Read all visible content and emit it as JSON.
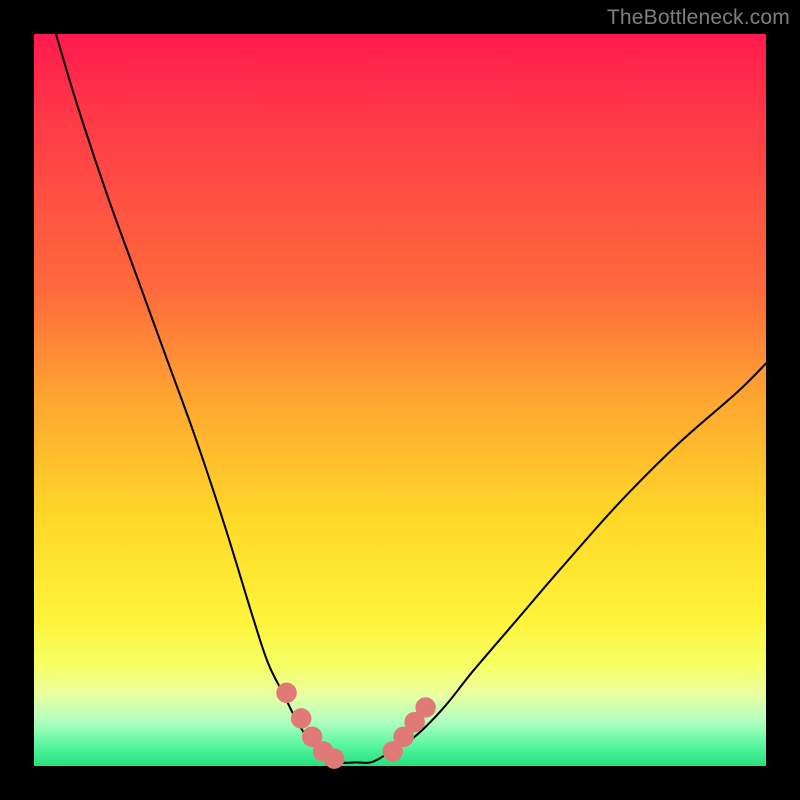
{
  "watermark": "TheBottleneck.com",
  "chart_data": {
    "type": "line",
    "title": "",
    "xlabel": "",
    "ylabel": "",
    "xlim": [
      0,
      100
    ],
    "ylim": [
      0,
      100
    ],
    "series": [
      {
        "name": "bottleneck-curve",
        "x": [
          3,
          6,
          10,
          14,
          18,
          22,
          26,
          30,
          32,
          34,
          36,
          38,
          40,
          42,
          44,
          46,
          48,
          52,
          56,
          60,
          66,
          72,
          80,
          88,
          96,
          100
        ],
        "y": [
          100,
          90,
          78,
          67,
          56,
          45,
          33,
          20,
          14,
          10,
          6,
          3,
          1.5,
          0.5,
          0.5,
          0.5,
          1.5,
          4,
          8,
          13,
          20,
          27,
          36,
          44,
          51,
          55
        ]
      }
    ],
    "markers": {
      "name": "highlighted-points",
      "color": "#e07a76",
      "points": [
        {
          "x": 34.5,
          "y": 10
        },
        {
          "x": 36.5,
          "y": 6.5
        },
        {
          "x": 38,
          "y": 4
        },
        {
          "x": 39.5,
          "y": 2
        },
        {
          "x": 41,
          "y": 1
        },
        {
          "x": 49,
          "y": 2
        },
        {
          "x": 50.5,
          "y": 4
        },
        {
          "x": 52,
          "y": 6
        },
        {
          "x": 53.5,
          "y": 8
        }
      ]
    },
    "gradient_stops": [
      {
        "pos": 0,
        "color": "#ff1a4e"
      },
      {
        "pos": 35,
        "color": "#ff6a3c"
      },
      {
        "pos": 66,
        "color": "#ffd828"
      },
      {
        "pos": 86,
        "color": "#f7ff60"
      },
      {
        "pos": 100,
        "color": "#23e07e"
      }
    ]
  }
}
